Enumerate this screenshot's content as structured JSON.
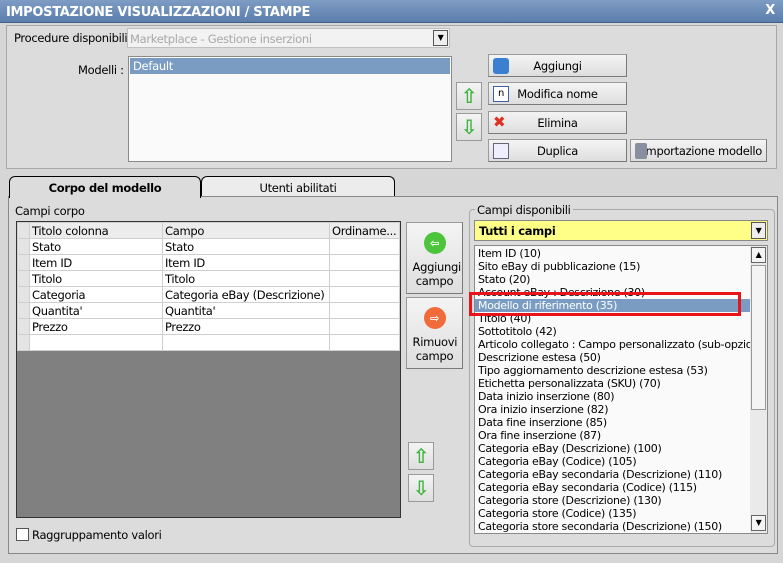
{
  "title": "IMPOSTAZIONE VISUALIZZAZIONI / STAMPE",
  "procedure_label": "Procedure disponibili :",
  "procedure_value": "Marketplace - Gestione inserzioni",
  "modelli_label": "Modelli :",
  "modelli": [
    "Default"
  ],
  "buttons": {
    "aggiungi": "Aggiungi",
    "modifica": "Modifica nome",
    "elimina": "Elimina",
    "duplica": "Duplica",
    "importa": "Importazione modello"
  },
  "tabs": [
    "Corpo del modello",
    "Utenti abilitati"
  ],
  "campi_corpo_label": "Campi corpo",
  "grid": {
    "headers": [
      "Titolo colonna",
      "Campo",
      "Ordiname..."
    ],
    "rows": [
      [
        "Stato",
        "Stato",
        ""
      ],
      [
        "Item ID",
        "Item ID",
        ""
      ],
      [
        "Titolo",
        "Titolo",
        ""
      ],
      [
        "Categoria",
        "Categoria eBay (Descrizione)",
        ""
      ],
      [
        "Quantita'",
        "Quantita'",
        ""
      ],
      [
        "Prezzo",
        "Prezzo",
        ""
      ],
      [
        "",
        "",
        ""
      ]
    ]
  },
  "aggiungi_campo": "Aggiungi campo",
  "rimuovi_campo": "Rimuovi campo",
  "raggruppamento": "Raggruppamento valori",
  "campi_disponibili_label": "Campi disponibili",
  "filter_value": "Tutti i campi",
  "campi": [
    "Item ID (10)",
    "Sito eBay di pubblicazione (15)",
    "Stato (20)",
    "Account eBay : Descrizione (30)",
    "Modello di riferimento (35)",
    "Titolo (40)",
    "Sottotitolo (42)",
    "Articolo collegato : Campo personalizzato (sub-opzione) (",
    "Descrizione estesa (50)",
    "Tipo aggiornamento descrizione estesa (53)",
    "Etichetta personalizzata (SKU) (70)",
    "Data inizio inserzione (80)",
    "Ora inizio inserzione (82)",
    "Data fine inserzione (85)",
    "Ora fine inserzione (87)",
    "Categoria eBay (Descrizione) (100)",
    "Categoria eBay (Codice) (105)",
    "Categoria eBay secondaria (Descrizione) (110)",
    "Categoria eBay secondaria (Codice) (115)",
    "Categoria store (Descrizione) (130)",
    "Categoria store (Codice) (135)",
    "Categoria store secondaria (Descrizione) (150)"
  ],
  "selected_index": 4,
  "colors": {
    "selection": "#7a9cc2",
    "highlight_box": "#e8141a",
    "filter_bg": "#ffff88"
  }
}
